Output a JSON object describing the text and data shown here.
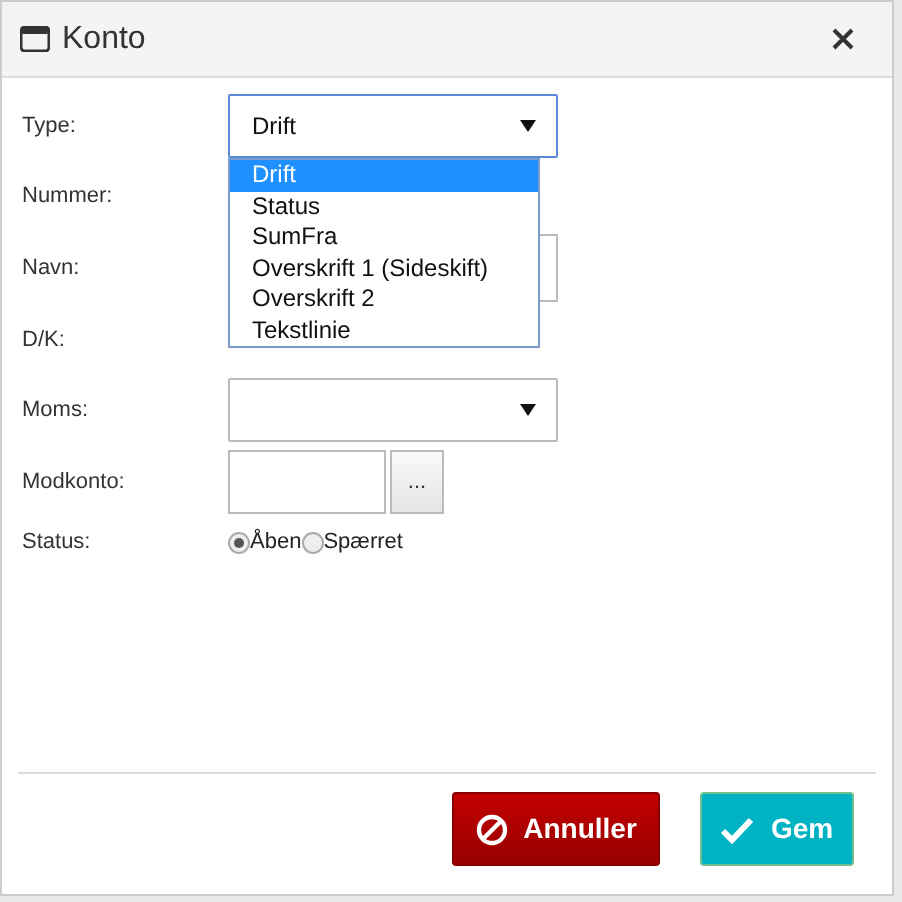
{
  "window": {
    "title": "Konto"
  },
  "fields": [
    {
      "kind": "select",
      "label": "Type:",
      "value": "Drift",
      "expanded": true,
      "options": [
        {
          "label": "Drift",
          "selected": true
        },
        {
          "label": "Status",
          "selected": false
        },
        {
          "label": "SumFra",
          "selected": false
        },
        {
          "label": "Overskrift 1 (Sideskift)",
          "selected": false
        },
        {
          "label": "Overskrift 2",
          "selected": false
        },
        {
          "label": "Tekstlinie",
          "selected": false
        }
      ]
    },
    {
      "kind": "hidden",
      "label": "Nummer:"
    },
    {
      "kind": "text",
      "label": "Navn:"
    },
    {
      "kind": "hidden",
      "label": "D/K:"
    },
    {
      "kind": "select",
      "label": "Moms:",
      "expanded": false
    },
    {
      "kind": "lookup",
      "label": "Modkonto:",
      "button": "..."
    },
    {
      "kind": "radio",
      "label": "Status:",
      "options": [
        {
          "label": "Åben",
          "selected": true
        },
        {
          "label": "Spærret",
          "selected": false
        }
      ]
    }
  ],
  "buttons": [
    {
      "kind": "cancel",
      "label": "Annuller"
    },
    {
      "kind": "save",
      "label": "Gem"
    }
  ]
}
